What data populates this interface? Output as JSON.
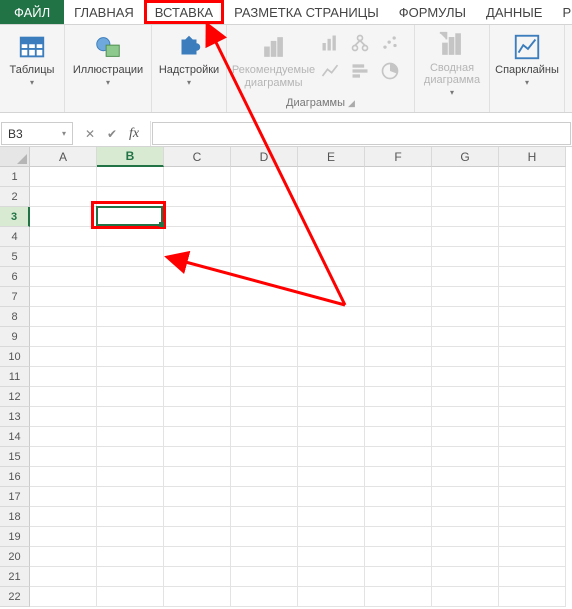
{
  "tabs": {
    "file": "ФАЙЛ",
    "home": "ГЛАВНАЯ",
    "insert": "ВСТАВКА",
    "page_layout": "РАЗМЕТКА СТРАНИЦЫ",
    "formulas": "ФОРМУЛЫ",
    "data": "ДАННЫЕ",
    "trail": "Р"
  },
  "ribbon": {
    "tables": {
      "label": "Таблицы"
    },
    "illustrations": {
      "label": "Иллюстрации"
    },
    "addins": {
      "label": "Надстройки"
    },
    "rec_charts": {
      "label": "Рекомендуемые диаграммы"
    },
    "charts_group": "Диаграммы",
    "pivot_chart": {
      "label": "Сводная диаграмма"
    },
    "sparklines": {
      "label": "Спарклайны"
    }
  },
  "formula_bar": {
    "name_box": "B3",
    "fx": "fx",
    "value": ""
  },
  "grid": {
    "columns": [
      "A",
      "B",
      "C",
      "D",
      "E",
      "F",
      "G",
      "H"
    ],
    "active_col": "B",
    "row_count": 22,
    "active_row": 3
  }
}
